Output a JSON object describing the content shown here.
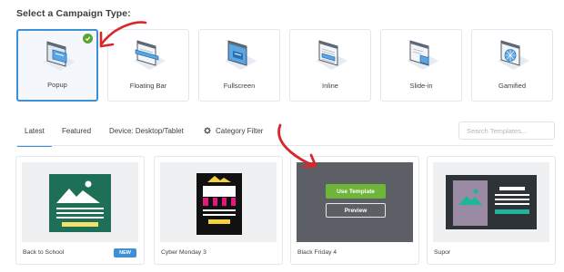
{
  "heading": "Select a Campaign Type:",
  "campaign_types": [
    {
      "label": "Popup",
      "selected": true
    },
    {
      "label": "Floating Bar",
      "selected": false
    },
    {
      "label": "Fullscreen",
      "selected": false
    },
    {
      "label": "Inline",
      "selected": false
    },
    {
      "label": "Slide-in",
      "selected": false
    },
    {
      "label": "Gamified",
      "selected": false
    }
  ],
  "tabs": {
    "latest": "Latest",
    "featured": "Featured",
    "device": "Device: Desktop/Tablet",
    "category_filter": "Category Filter",
    "search_placeholder": "Search Templates..."
  },
  "templates": [
    {
      "name": "Back to School",
      "badge": "NEW"
    },
    {
      "name": "Cyber Monday 3"
    },
    {
      "name": "Black Friday 4",
      "use_button": "Use Template",
      "preview_button": "Preview"
    },
    {
      "name": "Supor"
    }
  ],
  "colors": {
    "accent": "#3f8fd6",
    "selected_check": "#5aa532",
    "use_template": "#6fb53a",
    "annotation_arrow": "#d9262b",
    "back_to_school_bg": "#1d6f55",
    "cyber_monday_bg": "#111111",
    "supor_bg": "#2e3338",
    "overlay": "#5c6066"
  }
}
